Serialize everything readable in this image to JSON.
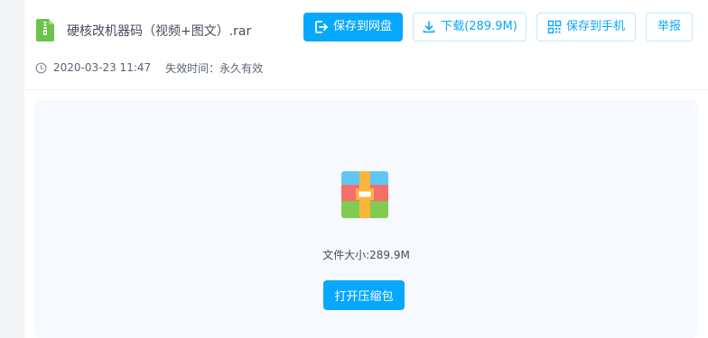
{
  "file": {
    "name": "硬核改机器码（视频+图文）.rar",
    "icon": "zip-file-icon",
    "date": "2020-03-23 11:47",
    "expire_label": "失效时间：",
    "expire_value": "永久有效"
  },
  "toolbar": {
    "save_label": "保存到网盘",
    "download_label": "下载(289.9M)",
    "phone_label": "保存到手机",
    "report_label": "举报"
  },
  "preview": {
    "icon": "rar-archive-icon",
    "size_label": "文件大小:",
    "size_value": "289.9M",
    "open_label": "打开压缩包"
  },
  "colors": {
    "accent": "#06a7ff",
    "page_bg": "#f3f4f6",
    "preview_bg": "#f6f9ff",
    "zip_icon": "#67c23a"
  }
}
